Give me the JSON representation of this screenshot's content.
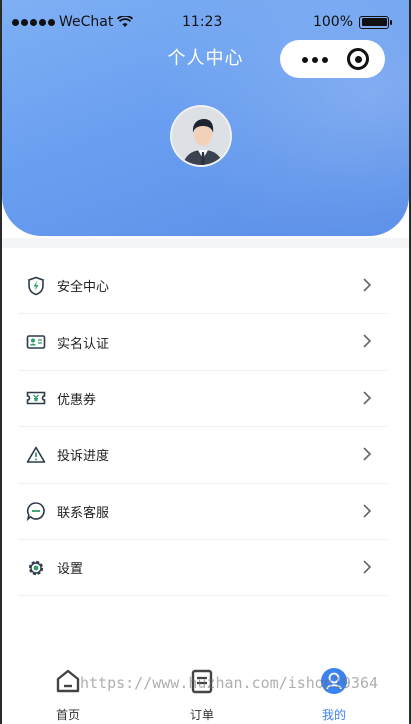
{
  "status_bar": {
    "carrier": "WeChat",
    "time": "11:23",
    "battery": "100%"
  },
  "header": {
    "title": "个人中心"
  },
  "menu": {
    "items": [
      {
        "label": "安全中心",
        "icon": "shield-icon"
      },
      {
        "label": "实名认证",
        "icon": "id-card-icon"
      },
      {
        "label": "优惠券",
        "icon": "coupon-icon"
      },
      {
        "label": "投诉进度",
        "icon": "warning-icon"
      },
      {
        "label": "联系客服",
        "icon": "chat-icon"
      },
      {
        "label": "设置",
        "icon": "gear-icon"
      }
    ]
  },
  "tabbar": {
    "tabs": [
      {
        "label": "首页",
        "icon": "home-icon"
      },
      {
        "label": "订单",
        "icon": "order-icon"
      },
      {
        "label": "我的",
        "icon": "profile-icon",
        "active": true
      }
    ]
  },
  "watermark": "https://www.huzhan.com/ishop19364",
  "colors": {
    "header_gradient_start": "#7fb0f5",
    "header_gradient_end": "#5a8ee8",
    "accent": "#3a82f0",
    "icon_green": "#2e9e6a"
  }
}
